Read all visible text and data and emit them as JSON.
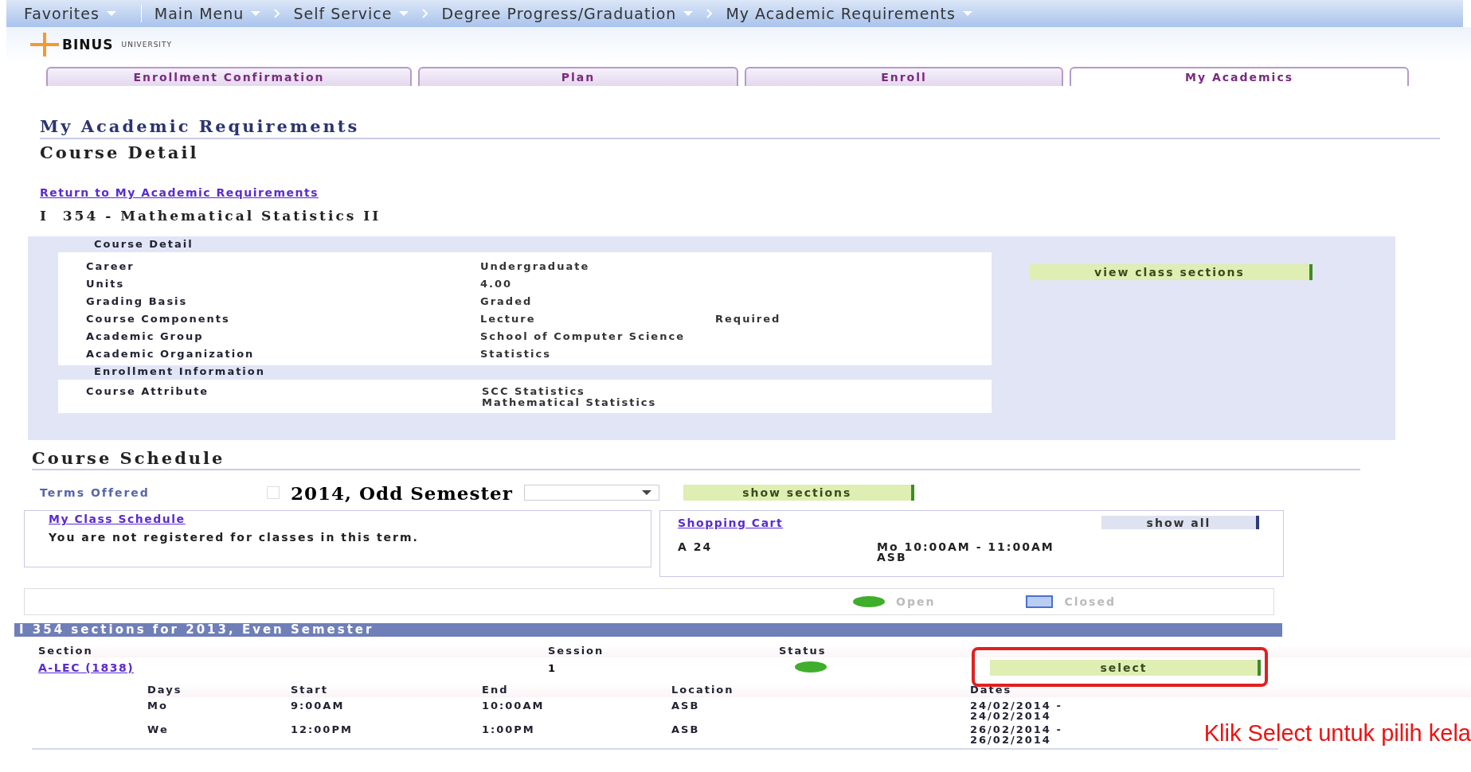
{
  "nav": {
    "breadcrumbs": [
      {
        "label": "Favorites"
      },
      {
        "label": "Main Menu"
      },
      {
        "label": "Self Service"
      },
      {
        "label": "Degree Progress/Graduation"
      },
      {
        "label": "My Academic Requirements"
      }
    ]
  },
  "logo": {
    "text": "BINUS",
    "subtext": "UNIVERSITY"
  },
  "tabs": [
    {
      "label": "Enrollment Confirmation",
      "selected": false
    },
    {
      "label": "Plan",
      "selected": false
    },
    {
      "label": "Enroll",
      "selected": false
    },
    {
      "label": "My Academics",
      "selected": true
    }
  ],
  "page_title": "My Academic Requirements",
  "subtitle": "Course Detail",
  "return_link": "Return to My Academic Requirements",
  "course_title": "I  354 - Mathematical Statistics II",
  "course_detail": {
    "heading": "Course Detail",
    "fields": [
      {
        "label": "Career",
        "value": "Undergraduate"
      },
      {
        "label": "Units",
        "value": "4.00"
      },
      {
        "label": "Grading Basis",
        "value": "Graded"
      },
      {
        "label": "Course Components",
        "value": "Lecture",
        "extra": "Required"
      },
      {
        "label": "Academic Group",
        "value": "School of Computer Science"
      },
      {
        "label": "Academic Organization",
        "value": "Statistics"
      }
    ],
    "enrollment_heading": "Enrollment Information",
    "attribute": {
      "label": "Course Attribute",
      "values": [
        "SCC Statistics",
        "Mathematical Statistics"
      ]
    },
    "button": "view class sections"
  },
  "schedule": {
    "heading": "Course Schedule",
    "terms_label": "Terms Offered",
    "term_checked": false,
    "term_value": "2014, Odd Semester",
    "show_button": "show sections"
  },
  "class_schedule": {
    "link": "My Class Schedule",
    "message": "You are not registered for classes in this term."
  },
  "shopping_cart": {
    "link": "Shopping Cart",
    "button": "show all",
    "items": [
      {
        "section": "A 24",
        "time": "Mo 10:00AM - 11:00AM",
        "location": "ASB"
      }
    ]
  },
  "legend": [
    {
      "label": "Open",
      "kind": "open"
    },
    {
      "label": "Closed",
      "kind": "closed"
    }
  ],
  "sections": {
    "title": "I 354 sections for 2013, Even Semester",
    "columns": [
      "Section",
      "Session",
      "Status"
    ],
    "rows": [
      {
        "section": "A-LEC (1838)",
        "session": "1",
        "open": true,
        "button": "select",
        "highlighted": true,
        "meeting_columns": [
          "Days",
          "Start",
          "End",
          "Location",
          "Dates"
        ],
        "meetings": [
          {
            "day": "Mo",
            "start": "9:00AM",
            "end": "10:00AM",
            "location": "ASB",
            "dates": "24/02/2014 - 24/02/2014"
          },
          {
            "day": "We",
            "start": "12:00PM",
            "end": "1:00PM",
            "location": "ASB",
            "dates": "26/02/2014 - 26/02/2014"
          }
        ]
      }
    ]
  },
  "annotation": "Klik Select untuk pilih kela"
}
